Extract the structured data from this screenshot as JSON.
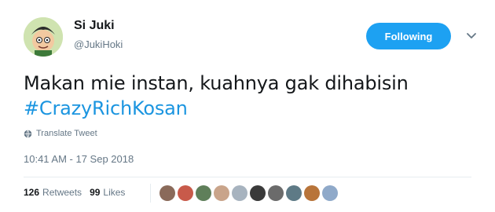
{
  "user": {
    "display_name": "Si Juki",
    "username": "@JukiHoki",
    "avatar_icon": "cartoon-avatar"
  },
  "follow_button": {
    "label": "Following",
    "color": "#1da1f2"
  },
  "tweet": {
    "text": "Makan mie instan, kuahnya gak dihabisin",
    "hashtag": "#CrazyRichKosan",
    "translate_label": "Translate Tweet",
    "timestamp": "10:41 AM - 17 Sep 2018"
  },
  "stats": {
    "retweets_count": "126",
    "retweets_label": "Retweets",
    "likes_count": "99",
    "likes_label": "Likes"
  },
  "likers": [
    {
      "color": "#8a6a5a"
    },
    {
      "color": "#c85a4a"
    },
    {
      "color": "#5f7f5a"
    },
    {
      "color": "#c9a48a"
    },
    {
      "color": "#a7b3bf"
    },
    {
      "color": "#3a3a3a"
    },
    {
      "color": "#6b6b6b"
    },
    {
      "color": "#5e7a86"
    },
    {
      "color": "#b8743a"
    },
    {
      "color": "#8fa9c9"
    }
  ],
  "colors": {
    "link": "#1b95e0",
    "muted": "#657786",
    "text": "#14171a"
  }
}
